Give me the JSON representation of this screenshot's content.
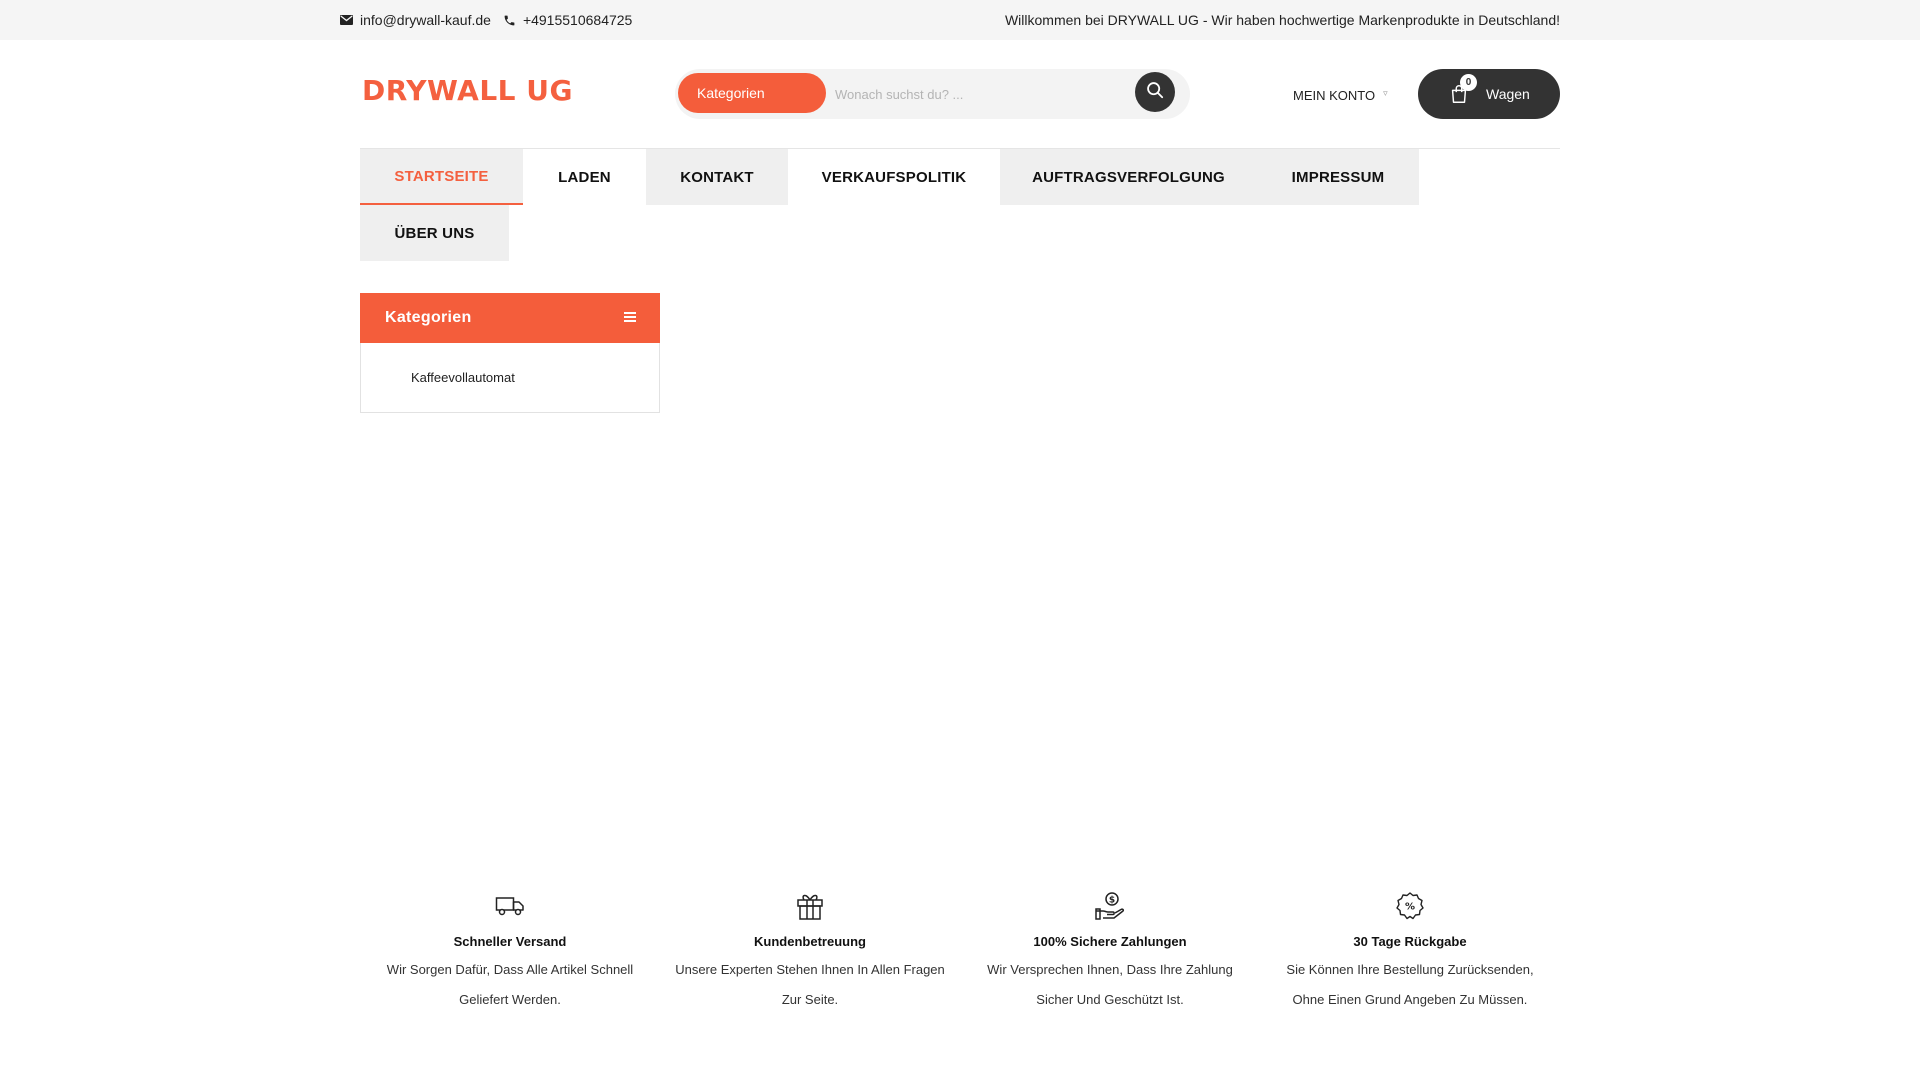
{
  "topbar": {
    "email": "info@drywall-kauf.de",
    "phone": "+4915510684725",
    "welcome": "Willkommen bei DRYWALL UG - Wir haben hochwertige Markenprodukte in Deutschland!"
  },
  "header": {
    "logo": "DRYWALL UG",
    "search": {
      "category_label": "Kategorien",
      "placeholder": "Wonach suchst du? ..."
    },
    "account_label": "MEIN KONTO",
    "cart": {
      "count": "0",
      "label": "Wagen"
    }
  },
  "nav": {
    "items": [
      {
        "label": "STARTSEITE"
      },
      {
        "label": "LADEN"
      },
      {
        "label": "KONTAKT"
      },
      {
        "label": "VERKAUFSPOLITIK"
      },
      {
        "label": "AUFTRAGSVERFOLGUNG"
      },
      {
        "label": "IMPRESSUM"
      },
      {
        "label": "ÜBER UNS"
      }
    ]
  },
  "categories": {
    "title": "Kategorien",
    "items": [
      {
        "label": "Kaffeevollautomat"
      }
    ]
  },
  "features": [
    {
      "icon": "truck-icon",
      "title": "Schneller Versand",
      "text": "Wir Sorgen Dafür, Dass Alle Artikel Schnell Geliefert Werden."
    },
    {
      "icon": "gift-icon",
      "title": "Kundenbetreuung",
      "text": "Unsere Experten Stehen Ihnen In Allen Fragen Zur Seite."
    },
    {
      "icon": "payment-hand-icon",
      "title": "100% Sichere Zahlungen",
      "text": "Wir Versprechen Ihnen, Dass Ihre Zahlung Sicher Und Geschützt Ist."
    },
    {
      "icon": "discount-badge-icon",
      "title": "30 Tage Rückgabe",
      "text": "Sie Können Ihre Bestellung Zurücksenden, Ohne Einen Grund Angeben Zu Müssen."
    }
  ],
  "colors": {
    "accent": "#f45d3b",
    "dark": "#333333",
    "nav_gray": "#efefef"
  }
}
